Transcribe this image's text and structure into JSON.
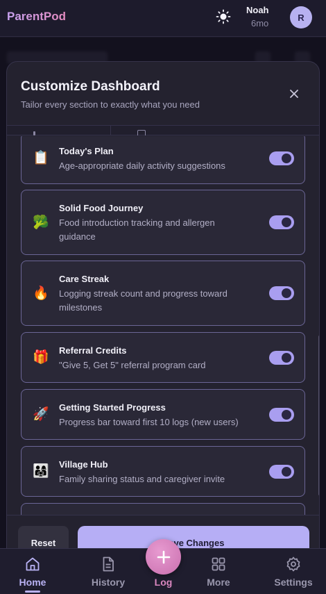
{
  "app": {
    "brand": "ParentPod"
  },
  "profile": {
    "name": "Noah",
    "age": "6mo",
    "avatar_initial": "R"
  },
  "modal": {
    "title": "Customize Dashboard",
    "subtitle": "Tailor every section to exactly what you need",
    "items": [
      {
        "icon": "📋",
        "icon_name": "clipboard-icon",
        "title": "Today's Plan",
        "description": "Age-appropriate daily activity suggestions",
        "enabled": true
      },
      {
        "icon": "🥦",
        "icon_name": "broccoli-icon",
        "title": "Solid Food Journey",
        "description": "Food introduction tracking and allergen guidance",
        "enabled": true
      },
      {
        "icon": "🔥",
        "icon_name": "fire-icon",
        "title": "Care Streak",
        "description": "Logging streak count and progress toward milestones",
        "enabled": true
      },
      {
        "icon": "🎁",
        "icon_name": "gift-icon",
        "title": "Referral Credits",
        "description": "\"Give 5, Get 5\" referral program card",
        "enabled": true
      },
      {
        "icon": "🚀",
        "icon_name": "rocket-icon",
        "title": "Getting Started Progress",
        "description": "Progress bar toward first 10 logs (new users)",
        "enabled": true
      },
      {
        "icon": "👨‍👩‍👧",
        "icon_name": "family-icon",
        "title": "Village Hub",
        "description": "Family sharing status and caregiver invite",
        "enabled": true
      }
    ],
    "reset_label": "Reset",
    "save_label": "Save Changes"
  },
  "nav": {
    "items": [
      {
        "label": "Home",
        "icon_name": "home-icon",
        "active": true
      },
      {
        "label": "History",
        "icon_name": "document-icon",
        "active": false
      },
      {
        "label": "More",
        "icon_name": "grid-icon",
        "active": false
      },
      {
        "label": "Settings",
        "icon_name": "gear-icon",
        "active": false
      }
    ],
    "fab_label": "Log"
  },
  "colors": {
    "accent": "#b6aef5",
    "fab": "#d97fbf",
    "background": "#1b1929"
  }
}
